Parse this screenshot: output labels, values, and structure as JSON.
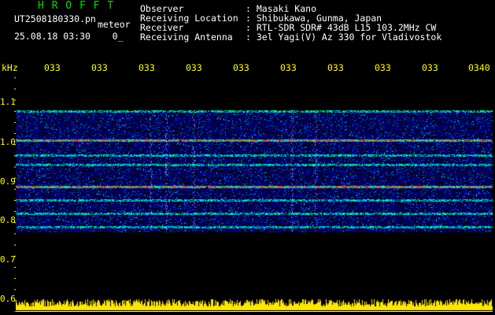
{
  "header": {
    "app_title": "H R O F F T",
    "file_name": "UT2508180330.pn",
    "file_tag": "meteor",
    "date_time": "25.08.18 03:30",
    "date_suffix": "0_"
  },
  "station_info": {
    "labels": [
      "Observer",
      "Receiving Location",
      "Receiver",
      "Receiving Antenna"
    ],
    "values": [
      ": Masaki Kano",
      ": Shibukawa, Gunma, Japan",
      ": RTL-SDR SDR# 43dB L15 103.2MHz CW",
      ": 3el Yagi(V) Az 330 for Vladivostok"
    ]
  },
  "axes": {
    "unit_label": "kHz",
    "time_ticks": [
      "033",
      "033",
      "033",
      "033",
      "033",
      "033",
      "033",
      "033",
      "033",
      "0340"
    ],
    "freq_ticks": [
      "1.1",
      "1.0",
      "0.9",
      "0.8",
      "0.7",
      "0.6"
    ]
  },
  "spectrogram": {
    "time_range": [
      "03:30",
      "03:40"
    ],
    "freq_range_khz": [
      0.6,
      1.13
    ],
    "signal_band_khz": [
      0.78,
      1.05
    ],
    "persistent_lines_khz": [
      1.05,
      0.985,
      0.95,
      0.93,
      0.88,
      0.85,
      0.82,
      0.79
    ],
    "strong_lines_khz": [
      0.985,
      0.88
    ],
    "colors": {
      "background": "#000000",
      "low": "#00008b",
      "mid": "#00c8ff",
      "high": "#00ff80",
      "peak": "#ff3030",
      "labels": "#ffff00",
      "title": "#00e000"
    }
  }
}
